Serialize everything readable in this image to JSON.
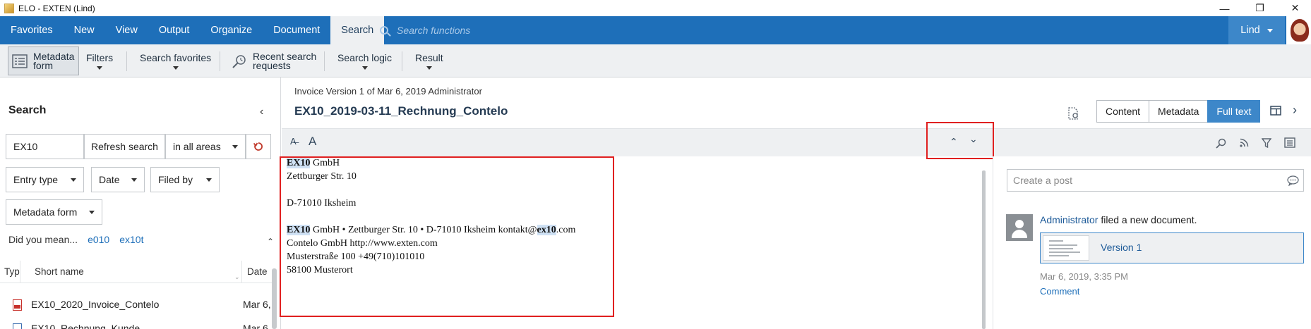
{
  "window": {
    "title": "ELO - EXTEN (Lind)",
    "controls": {
      "minimize": "—",
      "restore": "❐",
      "close": "✕"
    }
  },
  "menu": {
    "items": [
      "Favorites",
      "New",
      "View",
      "Output",
      "Organize",
      "Document",
      "Search"
    ],
    "active": "Search",
    "search_placeholder": "Search functions",
    "user": "Lind"
  },
  "ribbon": {
    "metadata_form": [
      "Metadata",
      "form"
    ],
    "filters": "Filters",
    "search_favorites": "Search favorites",
    "recent_search": [
      "Recent search",
      "requests"
    ],
    "search_logic": "Search logic",
    "result": "Result"
  },
  "search_panel": {
    "title": "Search",
    "query": "EX10",
    "refresh_label": "Refresh search",
    "scope": "in all areas",
    "filters": [
      "Entry type",
      "Date",
      "Filed by",
      "Metadata form"
    ],
    "did_you_mean_label": "Did you mean...",
    "suggestions": [
      "e010",
      "ex10t"
    ],
    "columns": [
      "Typ",
      "Short name",
      "Date"
    ],
    "rows": [
      {
        "name": "EX10_2020_Invoice_Contelo",
        "date": "Mar 6,"
      },
      {
        "name": "EX10_Rechnung_Kunde",
        "date": "Mar 6,"
      }
    ]
  },
  "document": {
    "meta": "Invoice  Version 1 of Mar 6, 2019  Administrator",
    "title": "EX10_2019-03-11_Rechnung_Contelo",
    "view_tabs": [
      "Content",
      "Metadata",
      "Full text"
    ],
    "active_view": "Full text"
  },
  "fulltext": {
    "line1_hl": "EX10",
    "line1_rest": " GmbH",
    "line2": "Zettburger Str. 10",
    "line3": "D-71010 Iksheim",
    "line4_hl1": "EX10",
    "line4_mid": " GmbH • Zettburger Str. 10 • D-71010 Iksheim kontakt@",
    "line4_hl2": "ex10",
    "line4_end": ".com",
    "line5": "Contelo GmbH http://www.exten.com",
    "line6": "Musterstraße 100 +49(710)101010",
    "line7": "58100 Musterort"
  },
  "feed": {
    "post_placeholder": "Create a post",
    "author": "Administrator",
    "action": " filed a new document.",
    "version_label": "Version 1",
    "timestamp": "Mar 6, 2019, 3:35 PM",
    "comment_label": "Comment"
  },
  "colors": {
    "menu_bar": "#1e6fb9",
    "active_tab": "#3d87c9",
    "highlight": "#cfe1f4",
    "annotation": "#e02020"
  }
}
